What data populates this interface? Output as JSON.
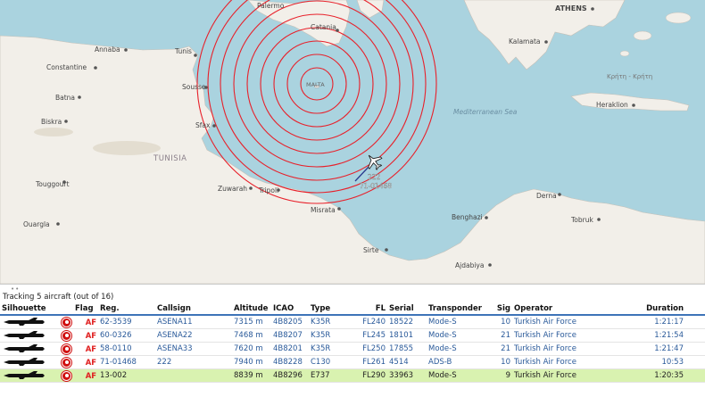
{
  "map": {
    "labels": {
      "palermo": "Palermo",
      "athens": "ATHENS",
      "catania": "Catania",
      "annaba": "Annaba",
      "tunis": "Tunis",
      "kalamata": "Kalamata",
      "constantine": "Constantine",
      "sousse": "Sousse",
      "malta": "MALTA",
      "kriti": "Κρήτη - Κρήτη",
      "batna": "Batna",
      "heraklion": "Heraklion",
      "med_sea": "Mediterranean Sea",
      "sfax": "Sfax",
      "biskra": "Biskra",
      "tunisia": "TUNISIA",
      "touggourt": "Touggourt",
      "zuwarah": "Zuwarah",
      "tripoli": "Tripoli",
      "derna": "Derna",
      "ouargla": "Ouargla",
      "misrata": "Misrata",
      "tobruk": "Tobruk",
      "benghazi": "Benghazi",
      "sirte": "Sirte",
      "ajdabiya": "Ajdabiya"
    },
    "aircraft_label": "222",
    "aircraft_reg": "71-01468"
  },
  "panel": {
    "grip": "••",
    "tracking_text": "Tracking 5 aircraft (out of 16)",
    "headers": {
      "silhouette": "Silhouette",
      "flag": "Flag",
      "reg": "Reg.",
      "callsign": "Callsign",
      "altitude": "Altitude",
      "icao": "ICAO",
      "type": "Type",
      "fl": "FL",
      "serial": "Serial",
      "transponder": "Transponder",
      "sig": "Sig",
      "operator": "Operator",
      "duration": "Duration"
    },
    "rows": [
      {
        "af": "AF",
        "reg": "62-3539",
        "callsign": "ASENA11",
        "altitude": "7315 m",
        "icao": "4B8205",
        "type": "K35R",
        "fl": "FL240",
        "serial": "18522",
        "transponder": "Mode-S",
        "sig": "10",
        "operator": "Turkish Air Force",
        "duration": "1:21:17"
      },
      {
        "af": "AF",
        "reg": "60-0326",
        "callsign": "ASENA22",
        "altitude": "7468 m",
        "icao": "4B8207",
        "type": "K35R",
        "fl": "FL245",
        "serial": "18101",
        "transponder": "Mode-S",
        "sig": "21",
        "operator": "Turkish Air Force",
        "duration": "1:21:54"
      },
      {
        "af": "AF",
        "reg": "58-0110",
        "callsign": "ASENA33",
        "altitude": "7620 m",
        "icao": "4B8201",
        "type": "K35R",
        "fl": "FL250",
        "serial": "17855",
        "transponder": "Mode-S",
        "sig": "21",
        "operator": "Turkish Air Force",
        "duration": "1:21:47"
      },
      {
        "af": "AF",
        "reg": "71-01468",
        "callsign": "222",
        "altitude": "7940 m",
        "icao": "4B8228",
        "type": "C130",
        "fl": "FL261",
        "serial": "4514",
        "transponder": "ADS-B",
        "sig": "10",
        "operator": "Turkish Air Force",
        "duration": "10:53"
      },
      {
        "af": "AF",
        "reg": "13-002",
        "callsign": "",
        "altitude": "8839 m",
        "icao": "4B8296",
        "type": "E737",
        "fl": "FL290",
        "serial": "33963",
        "transponder": "Mode-S",
        "sig": "9",
        "operator": "Turkish Air Force",
        "duration": "1:20:35"
      }
    ],
    "selected_row": 4
  },
  "colors": {
    "sea": "#aad3df",
    "land": "#f2efe9",
    "range_rings": "#e8202a",
    "header_rule": "#3e74b8",
    "selected_row": "#d9f2b0"
  }
}
